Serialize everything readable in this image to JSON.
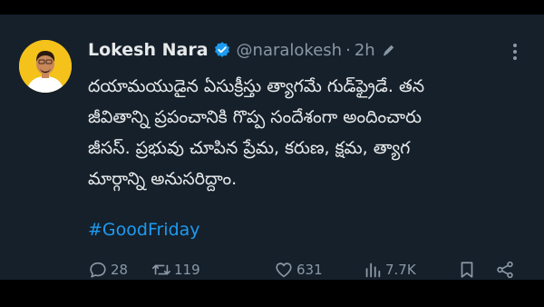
{
  "tweet": {
    "author_name": "Lokesh Nara",
    "handle": "@naralokesh",
    "separator": "·",
    "time": "2h",
    "text_lines": [
      "దయామయుడైన ఏసుక్రీస్తు త్యాగమే గుడ్‌ఫ్రైడే. తన",
      "జీవితాన్ని ప్రపంచానికి గొప్ప సందేశంగా అందించారు",
      "జీసస్.  ప్రభువు చూపిన ప్రేమ, కరుణ, క్షమ, త్యాగ",
      "మార్గాన్ని అనుసరిద్దాం."
    ],
    "hashtag": "#GoodFriday"
  },
  "stats": {
    "replies": "28",
    "retweets": "119",
    "likes": "631",
    "views": "7.7K"
  },
  "icons": {
    "verified": "verified-badge-icon",
    "edit": "edit-pencil-icon",
    "more": "more-options-icon",
    "reply": "reply-icon",
    "retweet": "retweet-icon",
    "like": "heart-icon",
    "views": "views-chart-icon",
    "bookmark": "bookmark-icon",
    "share": "share-icon"
  },
  "colors": {
    "background": "#15202b",
    "text": "#e7e9ea",
    "muted": "#8b98a5",
    "accent": "#1d9bf0",
    "avatar_bg": "#f4c21a"
  }
}
